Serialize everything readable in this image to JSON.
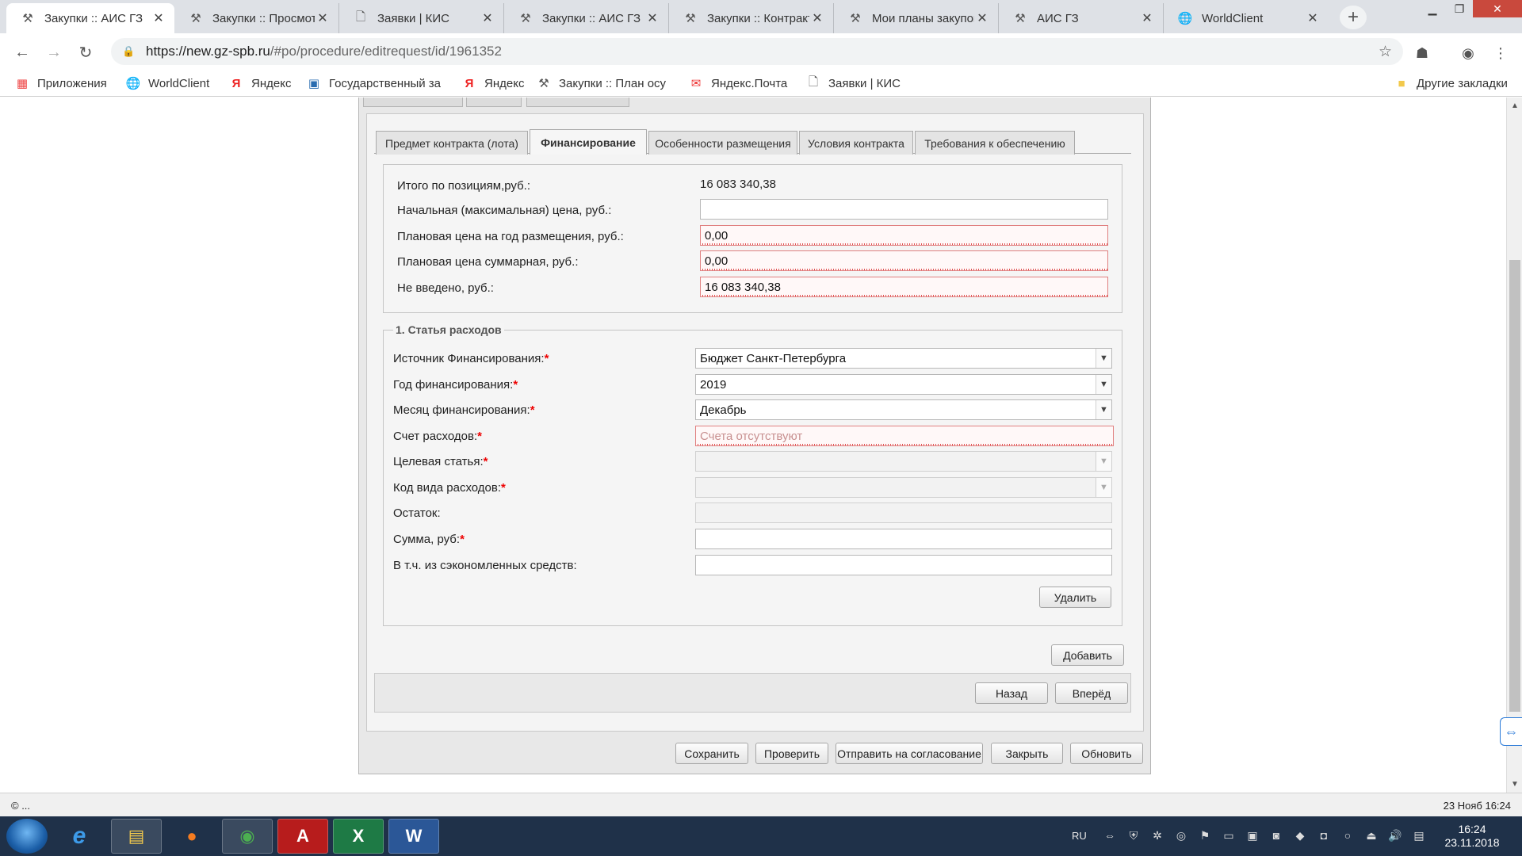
{
  "browser": {
    "tabs": [
      {
        "label": "Закупки :: АИС ГЗ",
        "icon": "tools-icon",
        "active": true
      },
      {
        "label": "Закупки :: Просмотр",
        "icon": "tools-icon"
      },
      {
        "label": "Заявки | КИС",
        "icon": "page-icon"
      },
      {
        "label": "Закупки :: АИС ГЗ",
        "icon": "tools-icon"
      },
      {
        "label": "Закупки :: Контракт",
        "icon": "tools-icon"
      },
      {
        "label": "Мои планы закупок",
        "icon": "tools-icon"
      },
      {
        "label": "АИС ГЗ",
        "icon": "tools-icon"
      },
      {
        "label": "WorldClient",
        "icon": "globe-icon"
      }
    ],
    "close_glyph": "✕",
    "newtab_glyph": "+",
    "url_host": "https://new.gz-spb.ru",
    "url_path": "/#po/procedure/editrequest/id/1961352",
    "bookmarks": [
      {
        "label": "Приложения",
        "icon": "apps-grid-icon"
      },
      {
        "label": "WorldClient",
        "icon": "globe-icon"
      },
      {
        "label": "Яндекс",
        "icon": "yandex-icon"
      },
      {
        "label": "Государственный за",
        "icon": "building-icon"
      },
      {
        "label": "Яндекс",
        "icon": "yandex-icon"
      },
      {
        "label": "Закупки :: План осу",
        "icon": "tools-icon"
      },
      {
        "label": "Яндекс.Почта",
        "icon": "mail-icon"
      },
      {
        "label": "Заявки | КИС",
        "icon": "page-icon"
      }
    ],
    "other_bookmarks": "Другие закладки"
  },
  "form": {
    "tabs": [
      {
        "label": "Предмет контракта (лота)"
      },
      {
        "label": "Финансирование",
        "active": true
      },
      {
        "label": "Особенности размещения"
      },
      {
        "label": "Условия контракта"
      },
      {
        "label": "Требования к обеспечению"
      }
    ],
    "summary": {
      "total_label": "Итого по позициям,руб.:",
      "total_value": "16 083 340,38",
      "nmc_label": "Начальная (максимальная) цена, руб.:",
      "nmc_value": "",
      "plan_year_label": "Плановая цена на год размещения, руб.:",
      "plan_year_value": "0,00",
      "plan_sum_label": "Плановая цена суммарная, руб.:",
      "plan_sum_value": "0,00",
      "not_entered_label": "Не введено, руб.:",
      "not_entered_value": "16 083 340,38"
    },
    "expense": {
      "legend": "1. Статья расходов",
      "source_label": "Источник Финансирования:",
      "source_value": "Бюджет Санкт-Петербурга",
      "year_label": "Год финансирования:",
      "year_value": "2019",
      "month_label": "Месяц финансирования:",
      "month_value": "Декабрь",
      "account_label": "Счет расходов:",
      "account_placeholder": "Счета отсутствуют",
      "target_label": "Целевая статья:",
      "kind_label": "Код вида расходов:",
      "rest_label": "Остаток:",
      "sum_label": "Сумма, руб:",
      "saved_label": "В т.ч. из сэкономленных средств:",
      "delete_button": "Удалить"
    },
    "required_mark": "*",
    "add_button": "Добавить",
    "back_button": "Назад",
    "forward_button": "Вперёд",
    "footer_buttons": {
      "save": "Сохранить",
      "check": "Проверить",
      "send": "Отправить на согласование",
      "close": "Закрыть",
      "refresh": "Обновить"
    }
  },
  "statusbar": {
    "left": "© ...",
    "right": "23 Нояб 16:24"
  },
  "taskbar": {
    "lang": "RU",
    "time": "16:24",
    "date": "23.11.2018",
    "apps": [
      {
        "name": "internet-explorer-icon",
        "glyph": "e"
      },
      {
        "name": "file-explorer-icon",
        "glyph": "▤"
      },
      {
        "name": "firefox-icon",
        "glyph": "●"
      },
      {
        "name": "chrome-icon",
        "glyph": "◉"
      },
      {
        "name": "acrobat-icon",
        "glyph": "A"
      },
      {
        "name": "excel-icon",
        "glyph": "X"
      },
      {
        "name": "word-icon",
        "glyph": "W"
      }
    ]
  },
  "colors": {
    "required": "#ee0000",
    "invalid_border": "#e08080",
    "taskbar": "#1f3149"
  }
}
